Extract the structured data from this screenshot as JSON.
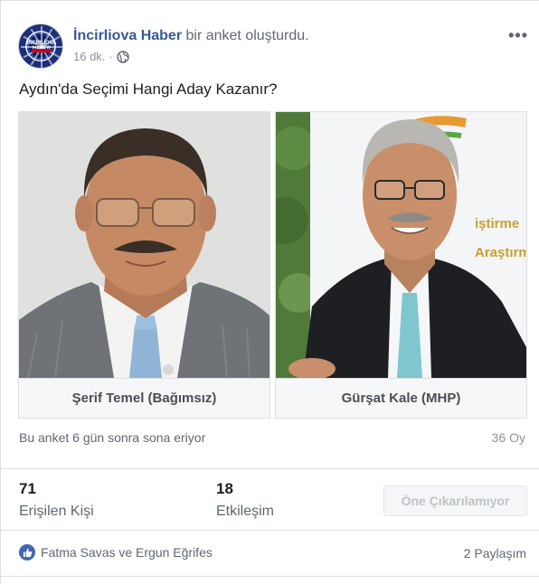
{
  "post": {
    "author": "İncirliova Haber",
    "action": "bir anket oluşturdu.",
    "time": "16 dk.",
    "separator": "·",
    "more_label": "•••",
    "avatar_text": "İNCİRLİOVA HABER"
  },
  "poll": {
    "question": "Aydın'da Seçimi Hangi Aday Kazanır?",
    "options": [
      {
        "label": "Şerif Temel (Bağımsız)"
      },
      {
        "label": "Gürşat Kale (MHP)"
      }
    ],
    "ends_text": "Bu anket 6 gün sonra sona eriyor",
    "votes": "36 Oy"
  },
  "insights": {
    "reach_value": "71",
    "reach_label": "Erişilen Kişi",
    "engagement_value": "18",
    "engagement_label": "Etkileşim",
    "boost_label": "Öne Çıkarılamıyor"
  },
  "footer": {
    "reactors": "Fatma Savas ve Ergun Eğrifes",
    "shares": "2 Paylaşım"
  },
  "colors": {
    "link": "#385898",
    "like": "#4267b2"
  }
}
